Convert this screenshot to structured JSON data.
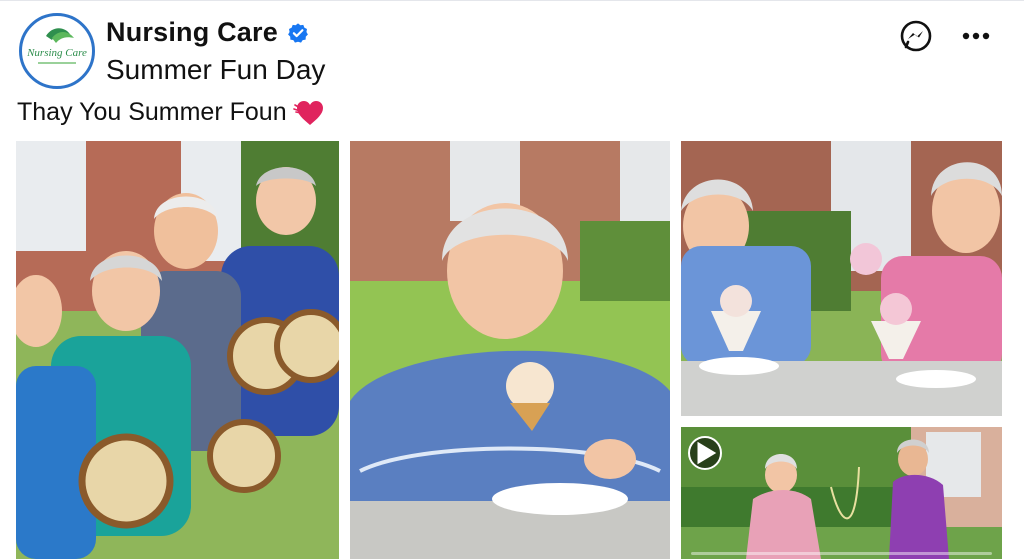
{
  "post": {
    "page_name": "Nursing Care",
    "title": "Summer Fun Day",
    "caption": "Thay You Summer Foun",
    "verified": true
  },
  "avatar": {
    "logo_text": "Nursing Care"
  },
  "icons": {
    "verified": "verified-badge-icon",
    "messenger": "messenger-icon",
    "more": "more-options-icon",
    "heart": "heart-icon",
    "play": "play-icon"
  },
  "colors": {
    "verified_blue": "#1877f2",
    "heart_red": "#e0245e",
    "logo_green": "#2f8f4e",
    "avatar_border": "#2e74c9"
  },
  "media": {
    "photos": [
      {
        "name": "residents-playing-tambourines"
      },
      {
        "name": "resident-eating-ice-cream"
      },
      {
        "name": "residents-with-sundaes"
      },
      {
        "name": "residents-dancing-video",
        "is_video": true,
        "progress": 0.0
      }
    ]
  }
}
